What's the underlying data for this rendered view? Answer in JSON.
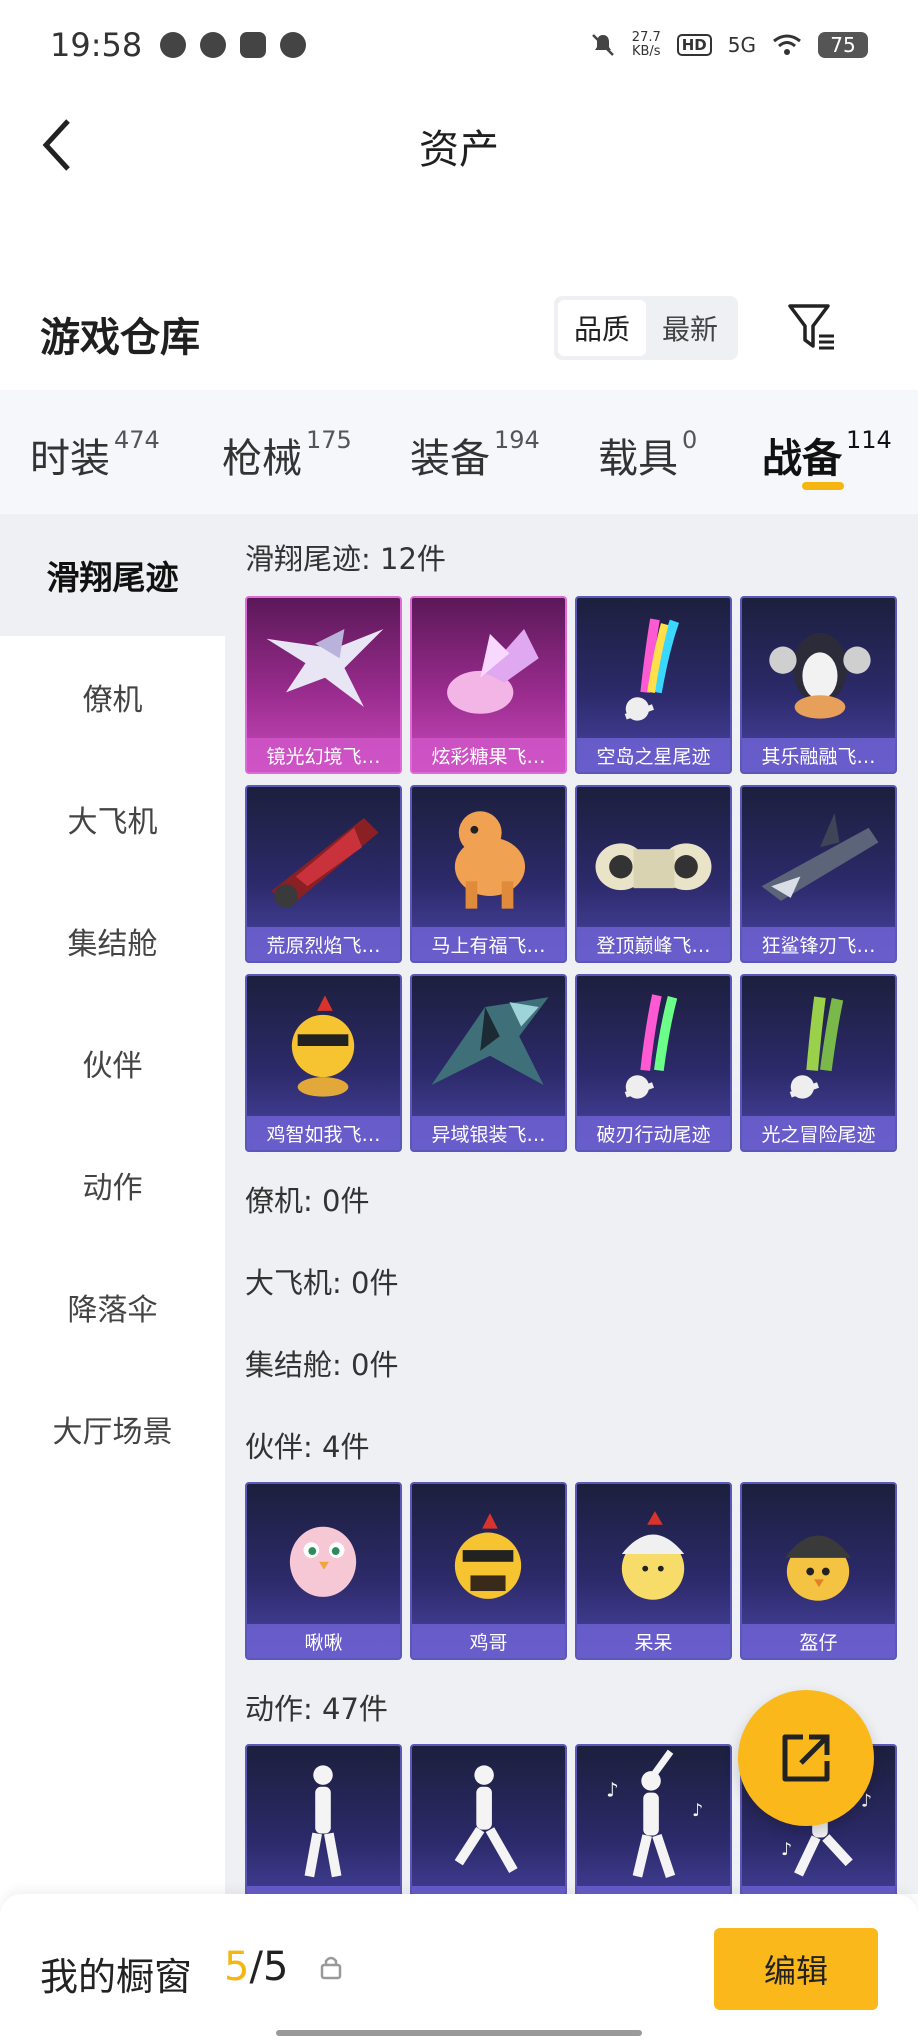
{
  "status_bar": {
    "time": "19:58",
    "net_speed_value": "27.7",
    "net_speed_unit": "KB/s",
    "hd": "HD",
    "signal": "5G",
    "battery": "75",
    "app_icons": [
      "wechat-icon",
      "browser-icon",
      "message-icon",
      "chat-icon"
    ]
  },
  "header": {
    "title": "资产"
  },
  "warehouse": {
    "title": "游戏仓库",
    "sort_options": [
      "品质",
      "最新"
    ],
    "sort_selected": "品质"
  },
  "tabs": [
    {
      "label": "时装",
      "count": "474"
    },
    {
      "label": "枪械",
      "count": "175"
    },
    {
      "label": "装备",
      "count": "194"
    },
    {
      "label": "载具",
      "count": "0"
    },
    {
      "label": "战备",
      "count": "114",
      "active": true
    }
  ],
  "side_menu": [
    {
      "label": "滑翔尾迹",
      "active": true
    },
    {
      "label": "僚机"
    },
    {
      "label": "大飞机"
    },
    {
      "label": "集结舱"
    },
    {
      "label": "伙伴"
    },
    {
      "label": "动作"
    },
    {
      "label": "降落伞"
    },
    {
      "label": "大厅场景"
    }
  ],
  "sections": {
    "glide": {
      "title": "滑翔尾迹: 12件",
      "items": [
        {
          "name": "镜光幻境飞…",
          "rarity": "pink",
          "art": "wing"
        },
        {
          "name": "炫彩糖果飞…",
          "rarity": "pink",
          "art": "candy"
        },
        {
          "name": "空岛之星尾迹",
          "art": "trail-rainbow"
        },
        {
          "name": "其乐融融飞…",
          "art": "penguin"
        },
        {
          "name": "荒原烈焰飞…",
          "art": "red-craft"
        },
        {
          "name": "马上有福飞…",
          "art": "horse"
        },
        {
          "name": "登顶巅峰飞…",
          "art": "jet"
        },
        {
          "name": "狂鲨锋刃飞…",
          "art": "shark"
        },
        {
          "name": "鸡智如我飞…",
          "art": "chick"
        },
        {
          "name": "异域银装飞…",
          "art": "ice-wing"
        },
        {
          "name": "破刃行动尾迹",
          "art": "trail-pastel"
        },
        {
          "name": "光之冒险尾迹",
          "art": "trail-green"
        }
      ]
    },
    "wingman": {
      "title": "僚机: 0件"
    },
    "big_plane": {
      "title": "大飞机: 0件"
    },
    "pod": {
      "title": "集结舱: 0件"
    },
    "partner": {
      "title": "伙伴: 4件",
      "items": [
        {
          "name": "啾啾",
          "art": "bird-pink"
        },
        {
          "name": "鸡哥",
          "art": "chicken-shades"
        },
        {
          "name": "呆呆",
          "art": "chick-cap"
        },
        {
          "name": "盔仔",
          "art": "chick-helmet"
        }
      ]
    },
    "emote": {
      "title": "动作: 47件",
      "items": [
        {
          "name": "",
          "art": "dancer-1"
        },
        {
          "name": "",
          "art": "dancer-2"
        },
        {
          "name": "",
          "art": "dancer-3"
        },
        {
          "name": "",
          "art": "dancer-4"
        }
      ]
    }
  },
  "bottom": {
    "label": "我的橱窗",
    "current": "5",
    "separator": "/",
    "total": "5",
    "edit_label": "编辑"
  },
  "colors": {
    "accent": "#fbb81a",
    "card_purple": "#2c2a6a",
    "card_pink": "#9a2c8e"
  }
}
